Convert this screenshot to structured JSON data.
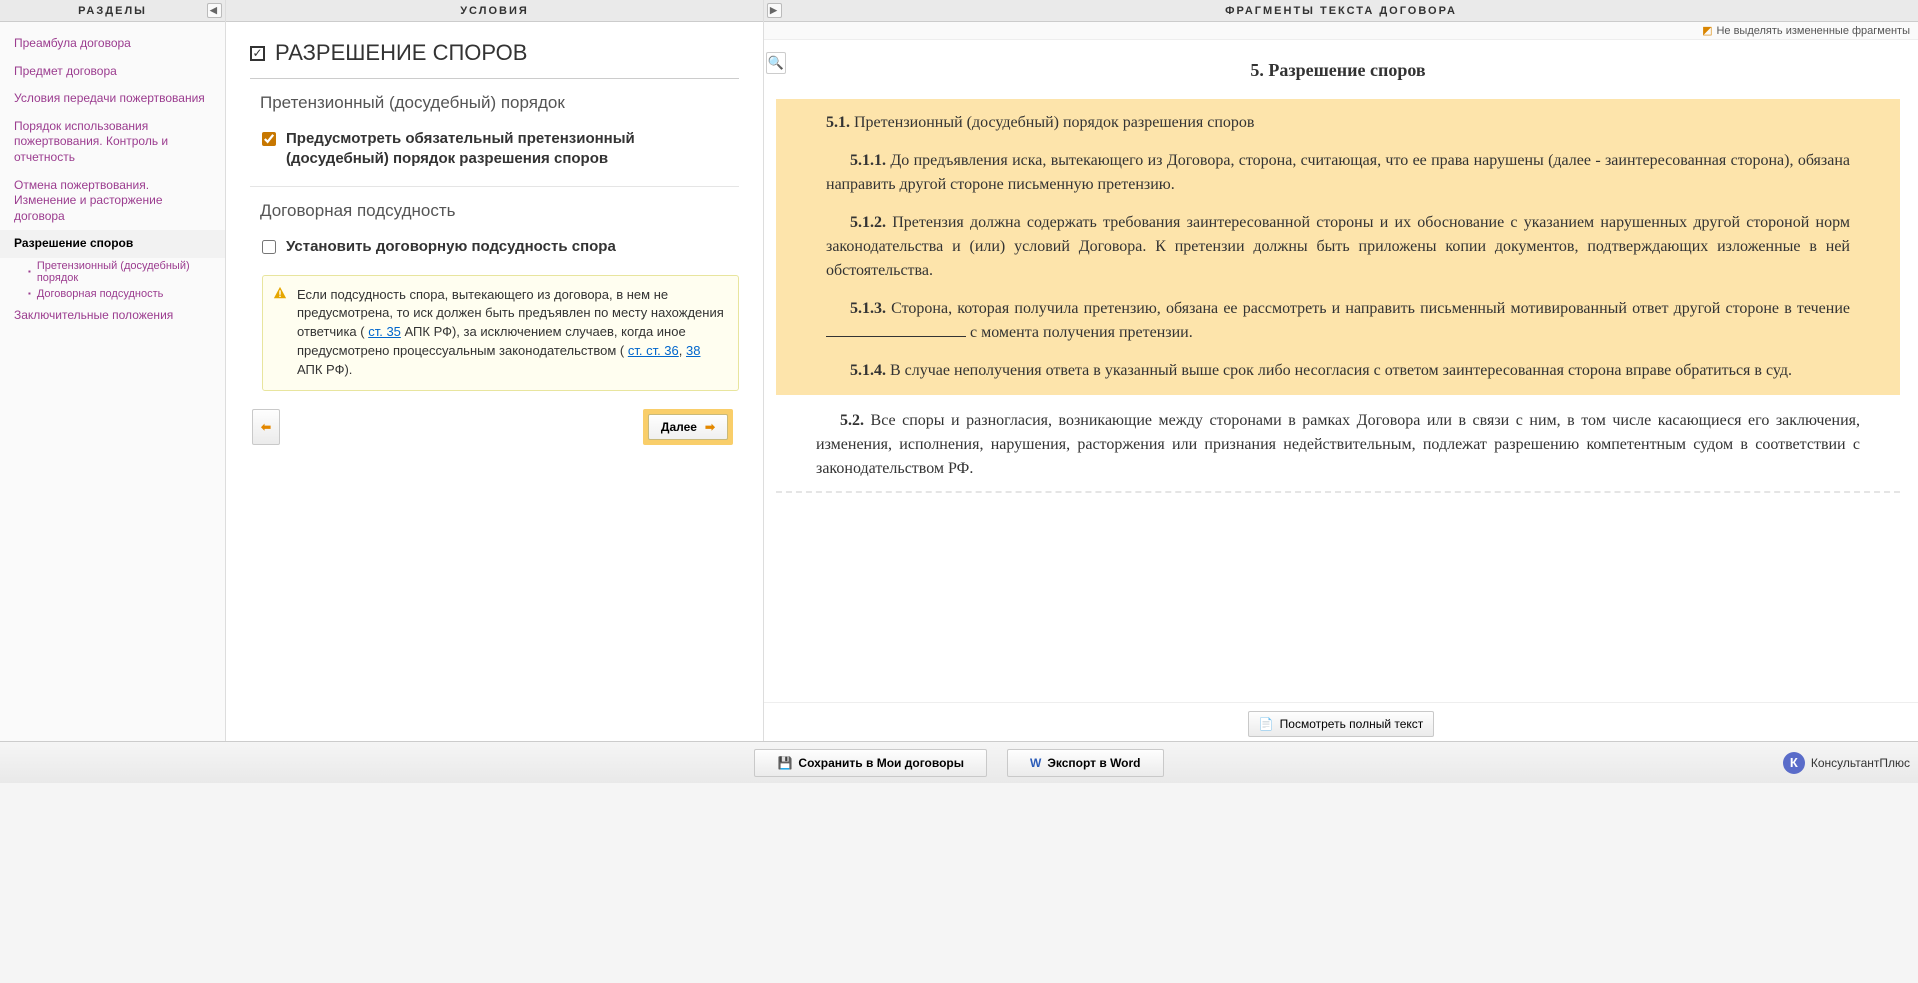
{
  "headers": {
    "left": "РАЗДЕЛЫ",
    "mid": "УСЛОВИЯ",
    "right": "ФРАГМЕНТЫ ТЕКСТА ДОГОВОРА"
  },
  "nav": {
    "items": [
      "Преамбула договора",
      "Предмет договора",
      "Условия  передачи пожертвования",
      "Порядок использования пожертвования. Контроль и отчетность",
      "Отмена пожертвования. Изменение и расторжение договора"
    ],
    "active": "Разрешение споров",
    "subs": [
      "Претензионный (досудебный) порядок",
      "Договорная подсудность"
    ],
    "after": "Заключительные положения"
  },
  "mid": {
    "title": "РАЗРЕШЕНИЕ СПОРОВ",
    "group1": "Претензионный (досудебный) порядок",
    "opt1": "Предусмотреть обязательный претензионный (досудебный) порядок разрешения споров",
    "group2": "Договорная подсудность",
    "opt2": "Установить договорную подсудность спора",
    "info_a": "Если подсудность спора, вытекающего из договора, в нем не предусмотрена, то иск должен быть предъявлен по месту нахождения ответчика ( ",
    "link1": "ст. 35",
    "info_b": " АПК РФ), за исключением случаев, когда иное предусмотрено процессуальным законодательством ( ",
    "link2": "ст. ст. 36",
    "info_c": ", ",
    "link3": "38",
    "info_d": " АПК РФ).",
    "next": "Далее"
  },
  "right": {
    "highlight_toggle": "Не выделять измененные фрагменты",
    "title_num": "5. ",
    "title": "Разрешение споров",
    "p51n": "5.1.",
    "p51": " Претензионный (досудебный) порядок разрешения споров",
    "p511n": "5.1.1.",
    "p511": " До предъявления иска, вытекающего из Договора, сторона, считающая, что ее права нарушены (далее - заинтересованная сторона), обязана направить другой стороне письменную претензию.",
    "p512n": "5.1.2.",
    "p512": " Претензия должна содержать требования заинтересованной стороны и их обоснование с указанием нарушенных другой стороной норм законодательства и (или) условий Договора. К претензии должны быть приложены копии документов, подтверждающих изложенные в ней обстоятельства.",
    "p513n": "5.1.3.",
    "p513a": " Сторона, которая получила претензию, обязана ее рассмотреть и направить письменный мотивированный ответ другой стороне в течение ",
    "p513b": " с момента получения претензии.",
    "p514n": "5.1.4.",
    "p514": " В случае неполучения ответа в указанный выше срок либо несогласия с ответом заинтересованная сторона вправе обратиться в суд.",
    "p52n": "5.2.",
    "p52": " Все споры и разногласия, возникающие между сторонами в рамках Договора или в связи с ним, в том числе касающиеся его заключения, изменения, исполнения, нарушения, расторжения или признания недействительным, подлежат разрешению компетентным судом в соответствии с законодательством РФ.",
    "view_full": "Посмотреть полный текст"
  },
  "bottom": {
    "save": "Сохранить в Мои договоры",
    "export": "Экспорт в Word",
    "brand": "КонсультантПлюс"
  }
}
